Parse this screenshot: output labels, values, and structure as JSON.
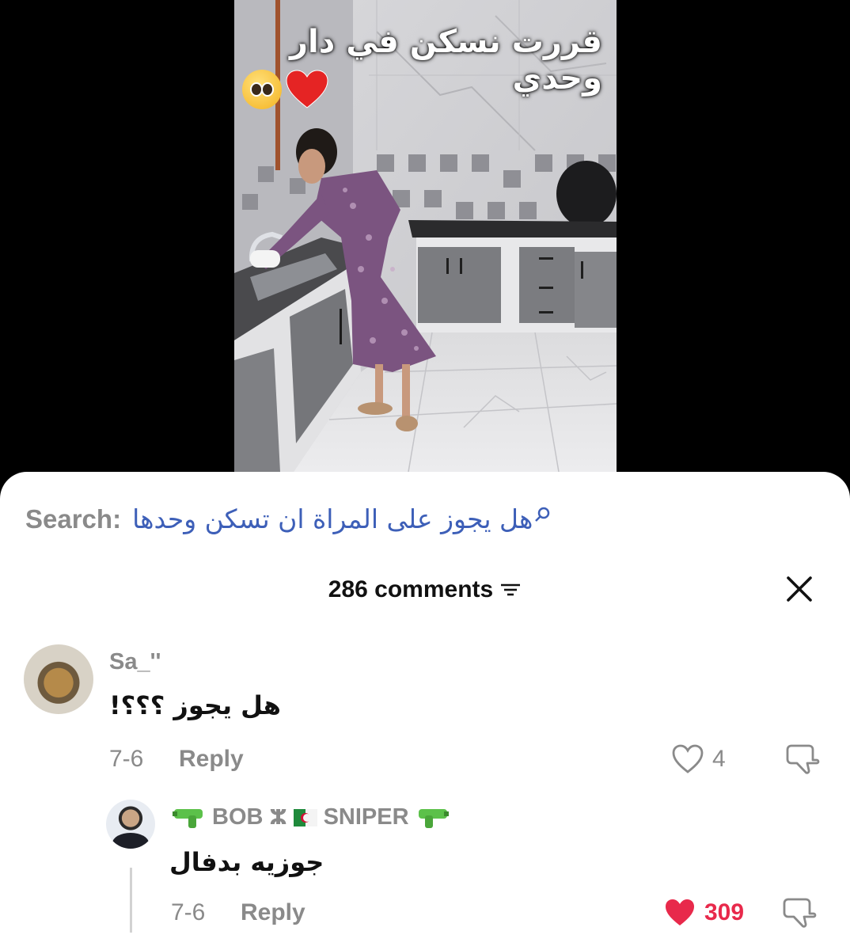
{
  "video": {
    "overlay_title": "قررت نسكن في دار وحدي",
    "overlay_emojis": [
      "pleading-face-emoji",
      "red-heart-emoji"
    ]
  },
  "search": {
    "label": "Search:",
    "query": "هل يجوز على المراة ان تسكن وحدها"
  },
  "header": {
    "comments_count": "286 comments"
  },
  "comments": [
    {
      "username": "Sa_''",
      "text": "هل يجوز ؟؟؟!",
      "date": "7-6",
      "reply_label": "Reply",
      "likes": "4",
      "liked": false
    }
  ],
  "replies": [
    {
      "username_left_icon": "water-pistol-emoji",
      "username_part1": "BOB",
      "username_symbol": "ⵣ",
      "username_flag": "algeria-flag",
      "username_part2": "SNIPER",
      "username_right_icon": "water-pistol-emoji",
      "text": "جوزيه بدفال",
      "date": "7-6",
      "reply_label": "Reply",
      "likes": "309",
      "liked": true
    }
  ],
  "colors": {
    "link_blue": "#3d5fb8",
    "like_red": "#e8294b",
    "muted_grey": "#8a8a8a"
  }
}
